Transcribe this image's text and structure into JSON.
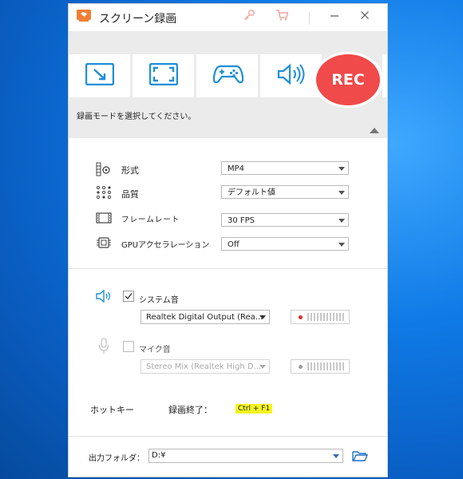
{
  "window": {
    "title": "スクリーン録画",
    "title_icons": [
      "app-logo-icon",
      "key-icon",
      "cart-icon",
      "minimize-icon",
      "close-icon"
    ],
    "accent_color": "#1e8fd8",
    "rec_color": "#f04a4a"
  },
  "modes": {
    "tiles": [
      {
        "icon": "region-capture-icon"
      },
      {
        "icon": "fullscreen-capture-icon"
      },
      {
        "icon": "game-capture-icon"
      },
      {
        "icon": "audio-capture-icon"
      }
    ],
    "rec_label": "REC",
    "hint": "録画モードを選択してください。"
  },
  "settings": {
    "format": {
      "label": "形式",
      "value": "MP4",
      "icon": "format-gear-icon"
    },
    "quality": {
      "label": "品質",
      "value": "デフォルト値",
      "icon": "quality-dots-icon"
    },
    "framerate": {
      "label": "フレームレート",
      "value": "30 FPS",
      "icon": "film-icon"
    },
    "gpu": {
      "label": "GPUアクセラレーション",
      "value": "Off",
      "icon": "chip-icon"
    }
  },
  "audio": {
    "system": {
      "label": "システム音",
      "checked": true,
      "device": "Realtek Digital Output (Rea...",
      "icon": "speaker-icon",
      "level_color": "#e02b2b"
    },
    "mic": {
      "label": "マイク音",
      "checked": false,
      "device": "Stereo Mix (Realtek High D...",
      "icon": "microphone-icon",
      "level_color": "#9a9a9a"
    }
  },
  "hotkey": {
    "label": "ホットキー",
    "action": "録画終了：",
    "value": "Ctrl + F1"
  },
  "output": {
    "label": "出力フォルダ：",
    "path": "D:¥",
    "folder_icon": "open-folder-icon"
  }
}
